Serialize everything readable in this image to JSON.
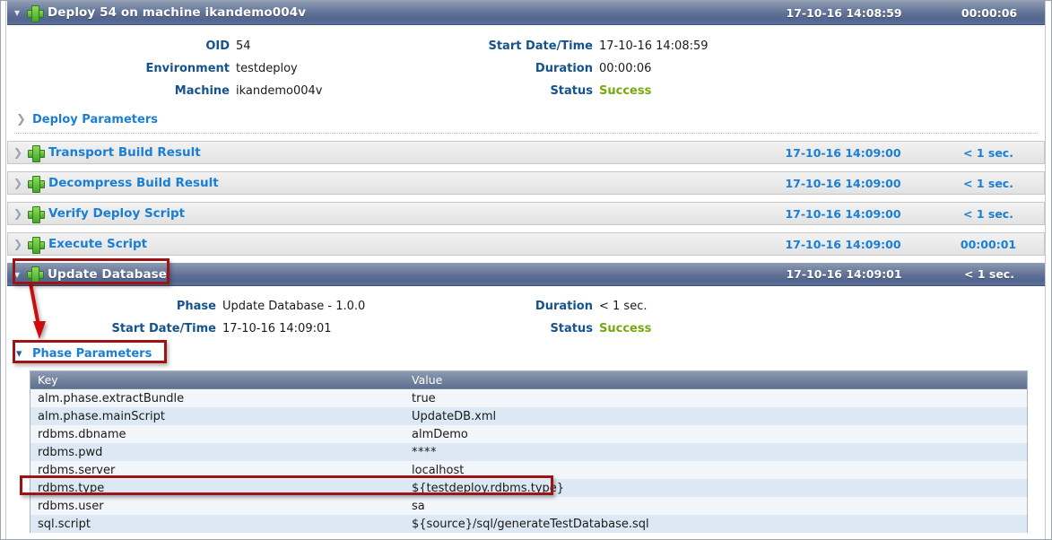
{
  "window": {
    "header": {
      "chevron": "down-chevron-icon",
      "status_icon": "green-plus-icon",
      "title": "Deploy 54 on machine ikandemo004v",
      "date": "17-10-16 14:08:59",
      "duration": "00:00:06"
    }
  },
  "summary": {
    "fields": [
      {
        "label": "OID",
        "value": "54"
      },
      {
        "label": "Start Date/Time",
        "value": "17-10-16 14:08:59"
      },
      {
        "label": "Environment",
        "value": "testdeploy"
      },
      {
        "label": "Duration",
        "value": "00:00:06"
      },
      {
        "label": "Machine",
        "value": "ikandemo004v"
      },
      {
        "label": "Status",
        "value": "Success"
      }
    ],
    "deploy_parameters_label": "Deploy Parameters"
  },
  "steps": [
    {
      "title": "Transport Build Result",
      "date": "17-10-16 14:09:00",
      "duration": "< 1 sec."
    },
    {
      "title": "Decompress Build Result",
      "date": "17-10-16 14:09:00",
      "duration": "< 1 sec."
    },
    {
      "title": "Verify Deploy Script",
      "date": "17-10-16 14:09:00",
      "duration": "< 1 sec."
    },
    {
      "title": "Execute Script",
      "date": "17-10-16 14:09:00",
      "duration": "00:00:01"
    }
  ],
  "expanded_phase": {
    "header": {
      "title": "Update Database",
      "date": "17-10-16 14:09:01",
      "duration": "< 1 sec."
    },
    "fields": [
      {
        "label": "Phase",
        "value": "Update Database - 1.0.0"
      },
      {
        "label": "Duration",
        "value": "< 1 sec."
      },
      {
        "label": "Start Date/Time",
        "value": "17-10-16 14:09:01"
      },
      {
        "label": "Status",
        "value": "Success"
      }
    ],
    "phase_parameters_label": "Phase Parameters",
    "table": {
      "columns": [
        "Key",
        "Value"
      ],
      "rows": [
        {
          "key": "alm.phase.extractBundle",
          "value": "true"
        },
        {
          "key": "alm.phase.mainScript",
          "value": "UpdateDB.xml"
        },
        {
          "key": "rdbms.dbname",
          "value": "almDemo"
        },
        {
          "key": "rdbms.pwd",
          "value": "****"
        },
        {
          "key": "rdbms.server",
          "value": "localhost"
        },
        {
          "key": "rdbms.type",
          "value": "${testdeploy.rdbms.type}"
        },
        {
          "key": "rdbms.user",
          "value": "sa"
        },
        {
          "key": "sql.script",
          "value": "${source}/sql/generateTestDatabase.sql"
        }
      ]
    }
  },
  "annotations": {
    "highlight_color": "#9e1414",
    "highlighted_items": [
      "Update Database",
      "Phase Parameters",
      "rdbms.type"
    ],
    "arrow": "red-arrow-from-update-database-to-phase-parameters"
  },
  "colors": {
    "title_bar": "#5f7095",
    "link_blue": "#1a7fd4",
    "label_blue": "#15538f",
    "success_green": "#77a80c",
    "row_odd": "#f2f6fa",
    "row_even": "#dce8f3"
  }
}
